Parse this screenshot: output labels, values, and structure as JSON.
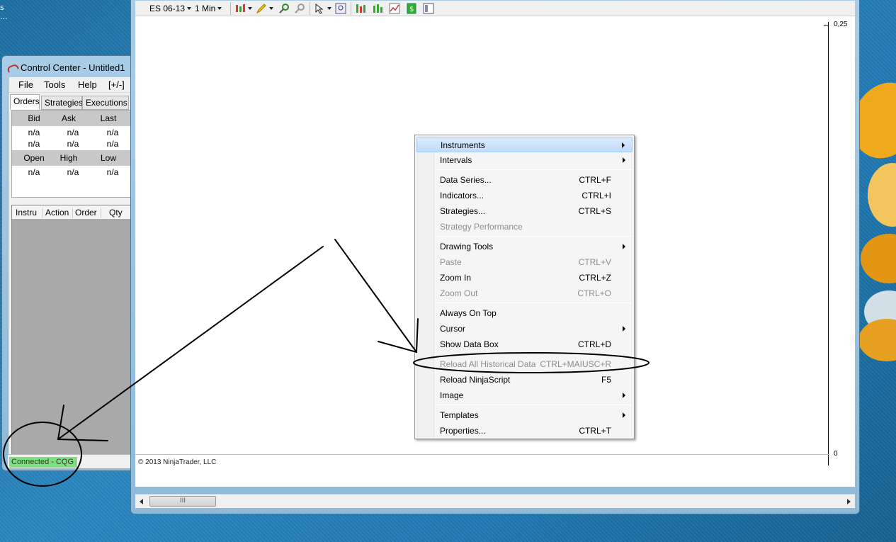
{
  "desktop": {
    "corner_text": "s\n..."
  },
  "control_center": {
    "title": "Control Center - Untitled1",
    "menu": [
      "File",
      "Tools",
      "Help",
      "[+/-]"
    ],
    "tabs": [
      "Orders",
      "Strategies",
      "Executions"
    ],
    "quote_headers_1": [
      "Bid",
      "Ask",
      "Last"
    ],
    "quote_row_1": [
      "n/a",
      "n/a",
      "n/a"
    ],
    "quote_row_2": [
      "n/a",
      "n/a",
      "n/a"
    ],
    "quote_headers_2": [
      "Open",
      "High",
      "Low"
    ],
    "quote_row_3": [
      "n/a",
      "n/a",
      "n/a"
    ],
    "grid_headers": [
      "Instru",
      "Action",
      "Order",
      "Qty"
    ],
    "status": "Connected - CQG"
  },
  "chart": {
    "instrument": "ES 06-13",
    "interval": "1 Min",
    "price_labels": [
      "0,25",
      "0"
    ],
    "copyright": "© 2013 NinjaTrader, LLC",
    "scroll_grip": "III"
  },
  "context_menu": {
    "items": [
      {
        "label": "Instruments",
        "shortcut": "",
        "submenu": true,
        "disabled": false
      },
      {
        "label": "Intervals",
        "shortcut": "",
        "submenu": true,
        "disabled": false
      },
      {
        "label": "Data Series...",
        "shortcut": "CTRL+F",
        "submenu": false,
        "disabled": false
      },
      {
        "label": "Indicators...",
        "shortcut": "CTRL+I",
        "submenu": false,
        "disabled": false
      },
      {
        "label": "Strategies...",
        "shortcut": "CTRL+S",
        "submenu": false,
        "disabled": false
      },
      {
        "label": "Strategy Performance",
        "shortcut": "",
        "submenu": false,
        "disabled": true
      },
      {
        "label": "Drawing Tools",
        "shortcut": "",
        "submenu": true,
        "disabled": false
      },
      {
        "label": "Paste",
        "shortcut": "CTRL+V",
        "submenu": false,
        "disabled": true
      },
      {
        "label": "Zoom In",
        "shortcut": "CTRL+Z",
        "submenu": false,
        "disabled": false
      },
      {
        "label": "Zoom Out",
        "shortcut": "CTRL+O",
        "submenu": false,
        "disabled": true
      },
      {
        "label": "Always On Top",
        "shortcut": "",
        "submenu": false,
        "disabled": false
      },
      {
        "label": "Cursor",
        "shortcut": "",
        "submenu": true,
        "disabled": false
      },
      {
        "label": "Show Data Box",
        "shortcut": "CTRL+D",
        "submenu": false,
        "disabled": false
      },
      {
        "label": "Reload All Historical Data",
        "shortcut": "CTRL+MAIUSC+R",
        "submenu": false,
        "disabled": true
      },
      {
        "label": "Reload NinjaScript",
        "shortcut": "F5",
        "submenu": false,
        "disabled": false
      },
      {
        "label": "Image",
        "shortcut": "",
        "submenu": true,
        "disabled": false
      },
      {
        "label": "Templates",
        "shortcut": "",
        "submenu": true,
        "disabled": false
      },
      {
        "label": "Properties...",
        "shortcut": "CTRL+T",
        "submenu": false,
        "disabled": false
      }
    ]
  },
  "colors": {
    "status_connected": "#7ee07e",
    "menu_highlight": "#c1dbfc",
    "annotation_ink": "#000000"
  }
}
